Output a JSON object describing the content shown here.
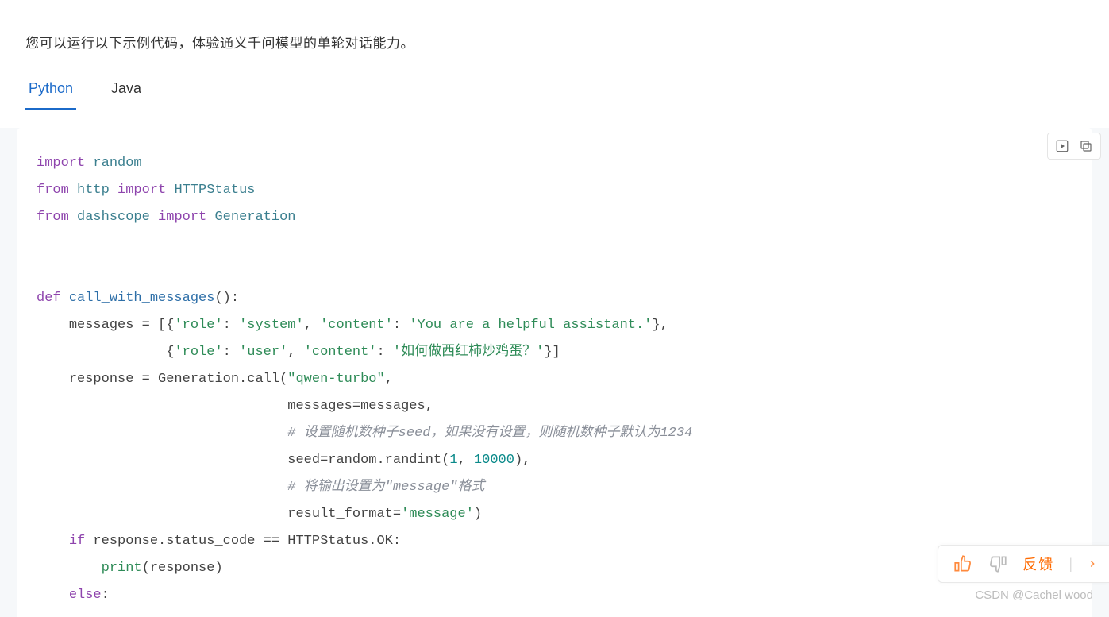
{
  "intro": "您可以运行以下示例代码，体验通义千问模型的单轮对话能力。",
  "tabs": {
    "python": "Python",
    "java": "Java"
  },
  "toolbar": {
    "run": "run-icon",
    "copy": "copy-icon"
  },
  "code": {
    "line1_import": "import",
    "line1_random": "random",
    "line2_from": "from",
    "line2_http": "http",
    "line2_import": "import",
    "line2_HTTPStatus": "HTTPStatus",
    "line3_from": "from",
    "line3_dashscope": "dashscope",
    "line3_import": "import",
    "line3_Generation": "Generation",
    "def": "def",
    "fn_name": "call_with_messages",
    "msgs_lhs": "messages = [{",
    "k_role": "'role'",
    "v_system": "'system'",
    "k_content": "'content'",
    "v_sys_content": "'You are a helpful assistant.'",
    "v_user": "'user'",
    "v_user_content": "'如何做西红柿炒鸡蛋？'",
    "response_lhs": "response = Generation.call(",
    "qwen": "\"qwen-turbo\"",
    "messages_kw": "messages=messages,",
    "cmt_seed": "# 设置随机数种子seed，如果没有设置，则随机数种子默认为1234",
    "seed_kw": "seed=random.randint(",
    "n1": "1",
    "n10000": "10000",
    "cmt_msg": "# 将输出设置为\"message\"格式",
    "result_kw": "result_format=",
    "v_message": "'message'",
    "if_kw": "if",
    "if_cond": "response.status_code == HTTPStatus.OK:",
    "print": "print",
    "print_arg": "(response)",
    "else_kw": "else",
    "colon": ":"
  },
  "feedback": {
    "label": "反馈"
  },
  "watermark": "CSDN @Cachel wood"
}
